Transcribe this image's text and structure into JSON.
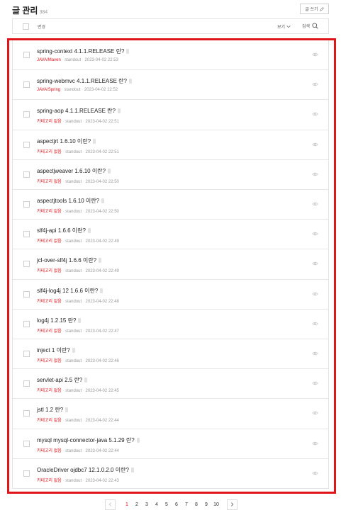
{
  "header": {
    "title": "글 관리",
    "count": "384",
    "write_label": "글 쓰기"
  },
  "toolbar": {
    "select_label": "변경",
    "view_label": "보기",
    "search_label": "검색"
  },
  "posts": [
    {
      "title": "spring-context 4.1.1.RELEASE 란?",
      "category": "JAVA/Maven",
      "author": "standout",
      "date": "2023-04-02 22:53"
    },
    {
      "title": "spring-webmvc 4.1.1.RELEASE 란?",
      "category": "JAVA/Spring",
      "author": "standout",
      "date": "2023-04-02 22:52"
    },
    {
      "title": "spring-aop 4.1.1.RELEASE 란?",
      "category": "카테고리 없음",
      "author": "standout",
      "date": "2023-04-02 22:51"
    },
    {
      "title": "aspectjrt 1.6.10 이란?",
      "category": "카테고리 없음",
      "author": "standout",
      "date": "2023-04-02 22:51"
    },
    {
      "title": "aspectjweaver 1.6.10 이란?",
      "category": "카테고리 없음",
      "author": "standout",
      "date": "2023-04-02 22:50"
    },
    {
      "title": "aspectjtools 1.6.10 이란?",
      "category": "카테고리 없음",
      "author": "standout",
      "date": "2023-04-02 22:50"
    },
    {
      "title": "slf4j-api 1.6.6 이란?",
      "category": "카테고리 없음",
      "author": "standout",
      "date": "2023-04-02 22:49"
    },
    {
      "title": "jcl-over-slf4j 1.6.6 이란?",
      "category": "카테고리 없음",
      "author": "standout",
      "date": "2023-04-02 22:49"
    },
    {
      "title": "slf4j-log4j 12 1.6.6 이란?",
      "category": "카테고리 없음",
      "author": "standout",
      "date": "2023-04-02 22:48"
    },
    {
      "title": "log4j 1.2.15 란?",
      "category": "카테고리 없음",
      "author": "standout",
      "date": "2023-04-02 22:47"
    },
    {
      "title": "inject 1 이란?",
      "category": "카테고리 없음",
      "author": "standout",
      "date": "2023-04-02 22:46"
    },
    {
      "title": "servlet-api 2.5 란?",
      "category": "카테고리 없음",
      "author": "standout",
      "date": "2023-04-02 22:45"
    },
    {
      "title": "jstl 1.2 란?",
      "category": "카테고리 없음",
      "author": "standout",
      "date": "2023-04-02 22:44"
    },
    {
      "title": "mysql mysql-connector-java 5.1.29 란?",
      "category": "카테고리 없음",
      "author": "standout",
      "date": "2023-04-02 22:44"
    },
    {
      "title": "OracleDriver ojdbc7 12.1.0.2.0 이란?",
      "category": "카테고리 없음",
      "author": "standout",
      "date": "2023-04-02 22:43"
    }
  ],
  "pagination": {
    "pages": [
      "1",
      "2",
      "3",
      "4",
      "5",
      "6",
      "7",
      "8",
      "9",
      "10"
    ],
    "current": "1"
  },
  "colors": {
    "accent": "#e0141b",
    "border": "#e3e3e3"
  },
  "icons": {
    "write": "pencil-icon",
    "view": "chevron-down-icon",
    "search": "search-icon",
    "row": "eye-icon",
    "prev": "chevron-left-icon",
    "next": "chevron-right-icon"
  }
}
